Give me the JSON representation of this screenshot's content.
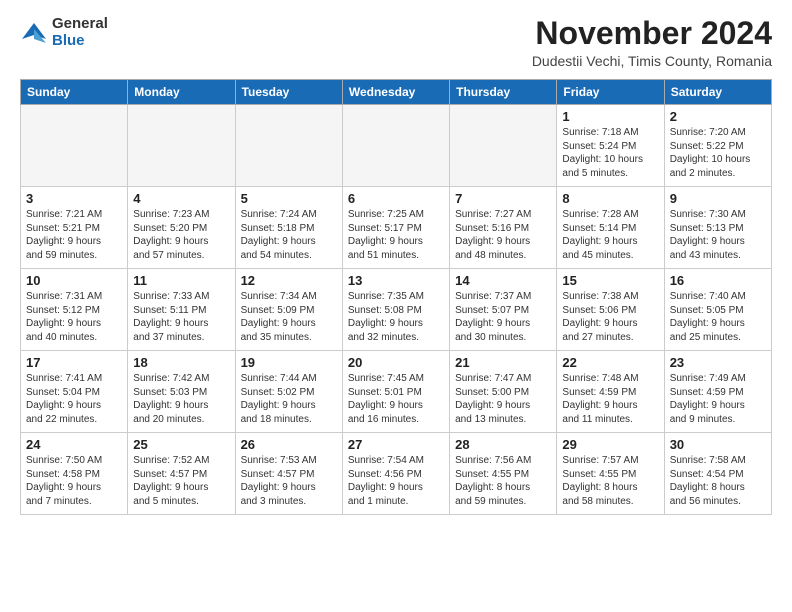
{
  "header": {
    "logo_general": "General",
    "logo_blue": "Blue",
    "month_title": "November 2024",
    "location": "Dudestii Vechi, Timis County, Romania"
  },
  "weekdays": [
    "Sunday",
    "Monday",
    "Tuesday",
    "Wednesday",
    "Thursday",
    "Friday",
    "Saturday"
  ],
  "weeks": [
    [
      {
        "day": "",
        "text": ""
      },
      {
        "day": "",
        "text": ""
      },
      {
        "day": "",
        "text": ""
      },
      {
        "day": "",
        "text": ""
      },
      {
        "day": "",
        "text": ""
      },
      {
        "day": "1",
        "text": "Sunrise: 7:18 AM\nSunset: 5:24 PM\nDaylight: 10 hours\nand 5 minutes."
      },
      {
        "day": "2",
        "text": "Sunrise: 7:20 AM\nSunset: 5:22 PM\nDaylight: 10 hours\nand 2 minutes."
      }
    ],
    [
      {
        "day": "3",
        "text": "Sunrise: 7:21 AM\nSunset: 5:21 PM\nDaylight: 9 hours\nand 59 minutes."
      },
      {
        "day": "4",
        "text": "Sunrise: 7:23 AM\nSunset: 5:20 PM\nDaylight: 9 hours\nand 57 minutes."
      },
      {
        "day": "5",
        "text": "Sunrise: 7:24 AM\nSunset: 5:18 PM\nDaylight: 9 hours\nand 54 minutes."
      },
      {
        "day": "6",
        "text": "Sunrise: 7:25 AM\nSunset: 5:17 PM\nDaylight: 9 hours\nand 51 minutes."
      },
      {
        "day": "7",
        "text": "Sunrise: 7:27 AM\nSunset: 5:16 PM\nDaylight: 9 hours\nand 48 minutes."
      },
      {
        "day": "8",
        "text": "Sunrise: 7:28 AM\nSunset: 5:14 PM\nDaylight: 9 hours\nand 45 minutes."
      },
      {
        "day": "9",
        "text": "Sunrise: 7:30 AM\nSunset: 5:13 PM\nDaylight: 9 hours\nand 43 minutes."
      }
    ],
    [
      {
        "day": "10",
        "text": "Sunrise: 7:31 AM\nSunset: 5:12 PM\nDaylight: 9 hours\nand 40 minutes."
      },
      {
        "day": "11",
        "text": "Sunrise: 7:33 AM\nSunset: 5:11 PM\nDaylight: 9 hours\nand 37 minutes."
      },
      {
        "day": "12",
        "text": "Sunrise: 7:34 AM\nSunset: 5:09 PM\nDaylight: 9 hours\nand 35 minutes."
      },
      {
        "day": "13",
        "text": "Sunrise: 7:35 AM\nSunset: 5:08 PM\nDaylight: 9 hours\nand 32 minutes."
      },
      {
        "day": "14",
        "text": "Sunrise: 7:37 AM\nSunset: 5:07 PM\nDaylight: 9 hours\nand 30 minutes."
      },
      {
        "day": "15",
        "text": "Sunrise: 7:38 AM\nSunset: 5:06 PM\nDaylight: 9 hours\nand 27 minutes."
      },
      {
        "day": "16",
        "text": "Sunrise: 7:40 AM\nSunset: 5:05 PM\nDaylight: 9 hours\nand 25 minutes."
      }
    ],
    [
      {
        "day": "17",
        "text": "Sunrise: 7:41 AM\nSunset: 5:04 PM\nDaylight: 9 hours\nand 22 minutes."
      },
      {
        "day": "18",
        "text": "Sunrise: 7:42 AM\nSunset: 5:03 PM\nDaylight: 9 hours\nand 20 minutes."
      },
      {
        "day": "19",
        "text": "Sunrise: 7:44 AM\nSunset: 5:02 PM\nDaylight: 9 hours\nand 18 minutes."
      },
      {
        "day": "20",
        "text": "Sunrise: 7:45 AM\nSunset: 5:01 PM\nDaylight: 9 hours\nand 16 minutes."
      },
      {
        "day": "21",
        "text": "Sunrise: 7:47 AM\nSunset: 5:00 PM\nDaylight: 9 hours\nand 13 minutes."
      },
      {
        "day": "22",
        "text": "Sunrise: 7:48 AM\nSunset: 4:59 PM\nDaylight: 9 hours\nand 11 minutes."
      },
      {
        "day": "23",
        "text": "Sunrise: 7:49 AM\nSunset: 4:59 PM\nDaylight: 9 hours\nand 9 minutes."
      }
    ],
    [
      {
        "day": "24",
        "text": "Sunrise: 7:50 AM\nSunset: 4:58 PM\nDaylight: 9 hours\nand 7 minutes."
      },
      {
        "day": "25",
        "text": "Sunrise: 7:52 AM\nSunset: 4:57 PM\nDaylight: 9 hours\nand 5 minutes."
      },
      {
        "day": "26",
        "text": "Sunrise: 7:53 AM\nSunset: 4:57 PM\nDaylight: 9 hours\nand 3 minutes."
      },
      {
        "day": "27",
        "text": "Sunrise: 7:54 AM\nSunset: 4:56 PM\nDaylight: 9 hours\nand 1 minute."
      },
      {
        "day": "28",
        "text": "Sunrise: 7:56 AM\nSunset: 4:55 PM\nDaylight: 8 hours\nand 59 minutes."
      },
      {
        "day": "29",
        "text": "Sunrise: 7:57 AM\nSunset: 4:55 PM\nDaylight: 8 hours\nand 58 minutes."
      },
      {
        "day": "30",
        "text": "Sunrise: 7:58 AM\nSunset: 4:54 PM\nDaylight: 8 hours\nand 56 minutes."
      }
    ]
  ]
}
